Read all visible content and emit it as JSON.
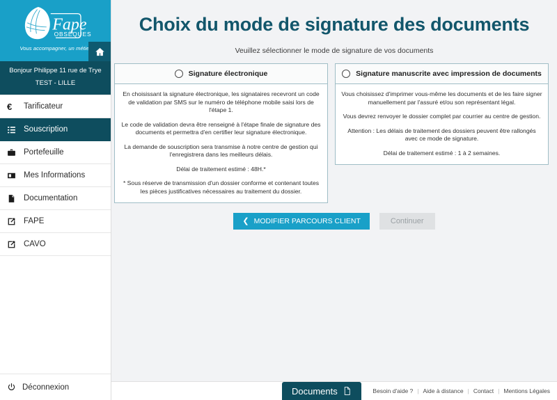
{
  "sidebar": {
    "brand": {
      "logo_name": "fape-obseques-logo",
      "logo_text": "Fape",
      "logo_subtext": "OBSÈQUES",
      "tagline": "Vous accompagner, un métier",
      "home_icon": "home-icon",
      "brand_color": "#19A0C8"
    },
    "user": {
      "greeting": "Bonjour Philippe 11 rue de Trye",
      "agency": "TEST - LILLE"
    },
    "items": [
      {
        "label": "Tarificateur",
        "icon": "euro-icon",
        "active": false
      },
      {
        "label": "Souscription",
        "icon": "list-icon",
        "active": true
      },
      {
        "label": "Portefeuille",
        "icon": "briefcase-icon",
        "active": false
      },
      {
        "label": "Mes Informations",
        "icon": "id-card-icon",
        "active": false
      },
      {
        "label": "Documentation",
        "icon": "pdf-file-icon",
        "active": false
      },
      {
        "label": "FAPE",
        "icon": "external-link-icon",
        "active": false
      },
      {
        "label": "CAVO",
        "icon": "external-link-icon",
        "active": false
      }
    ],
    "logout": {
      "label": "Déconnexion",
      "icon": "power-icon"
    }
  },
  "main": {
    "title": "Choix du mode de signature des documents",
    "subtitle": "Veuillez sélectionner le mode de signature de vos documents",
    "title_color": "#12566B",
    "cards": [
      {
        "title": "Signature électronique",
        "selected": false,
        "paragraphs": [
          "En choisissant la signature électronique, les signataires recevront un code de validation par SMS sur le numéro de téléphone mobile saisi lors de l'étape 1.",
          "Le code de validation devra être renseigné à l'étape finale de signature des documents et permettra d'en certifier leur signature électronique.",
          "La demande de souscription sera transmise à notre centre de gestion qui l'enregistrera dans les meilleurs délais.",
          "Délai de traitement estimé : 48H.*",
          "* Sous réserve de transmission d'un dossier conforme et contenant toutes les pièces justificatives nécessaires au traitement du dossier."
        ]
      },
      {
        "title": "Signature manuscrite avec impression de documents",
        "selected": false,
        "paragraphs": [
          "Vous choisissez d'imprimer vous-même les documents et de les faire signer manuellement par l'assuré et/ou son représentant légal.",
          "Vous devrez renvoyer le dossier complet par courrier au centre de gestion.",
          "Attention : Les délais de traitement des dossiers peuvent être rallongés avec ce mode de signature.",
          "Délai de traitement estimé : 1 à 2 semaines."
        ]
      }
    ],
    "actions": {
      "back_label": "MODIFIER PARCOURS CLIENT",
      "back_icon": "chevron-left-icon",
      "back_color": "#19A0C8",
      "continue_label": "Continuer",
      "continue_disabled": true
    }
  },
  "footer": {
    "documents_button": {
      "label": "Documents",
      "icon": "document-icon",
      "color": "#0E4D5E"
    },
    "links": [
      {
        "label": "Besoin d'aide ?"
      },
      {
        "label": "Aide à distance"
      },
      {
        "label": "Contact"
      },
      {
        "label": "Mentions Légales"
      }
    ],
    "separator": "|"
  }
}
